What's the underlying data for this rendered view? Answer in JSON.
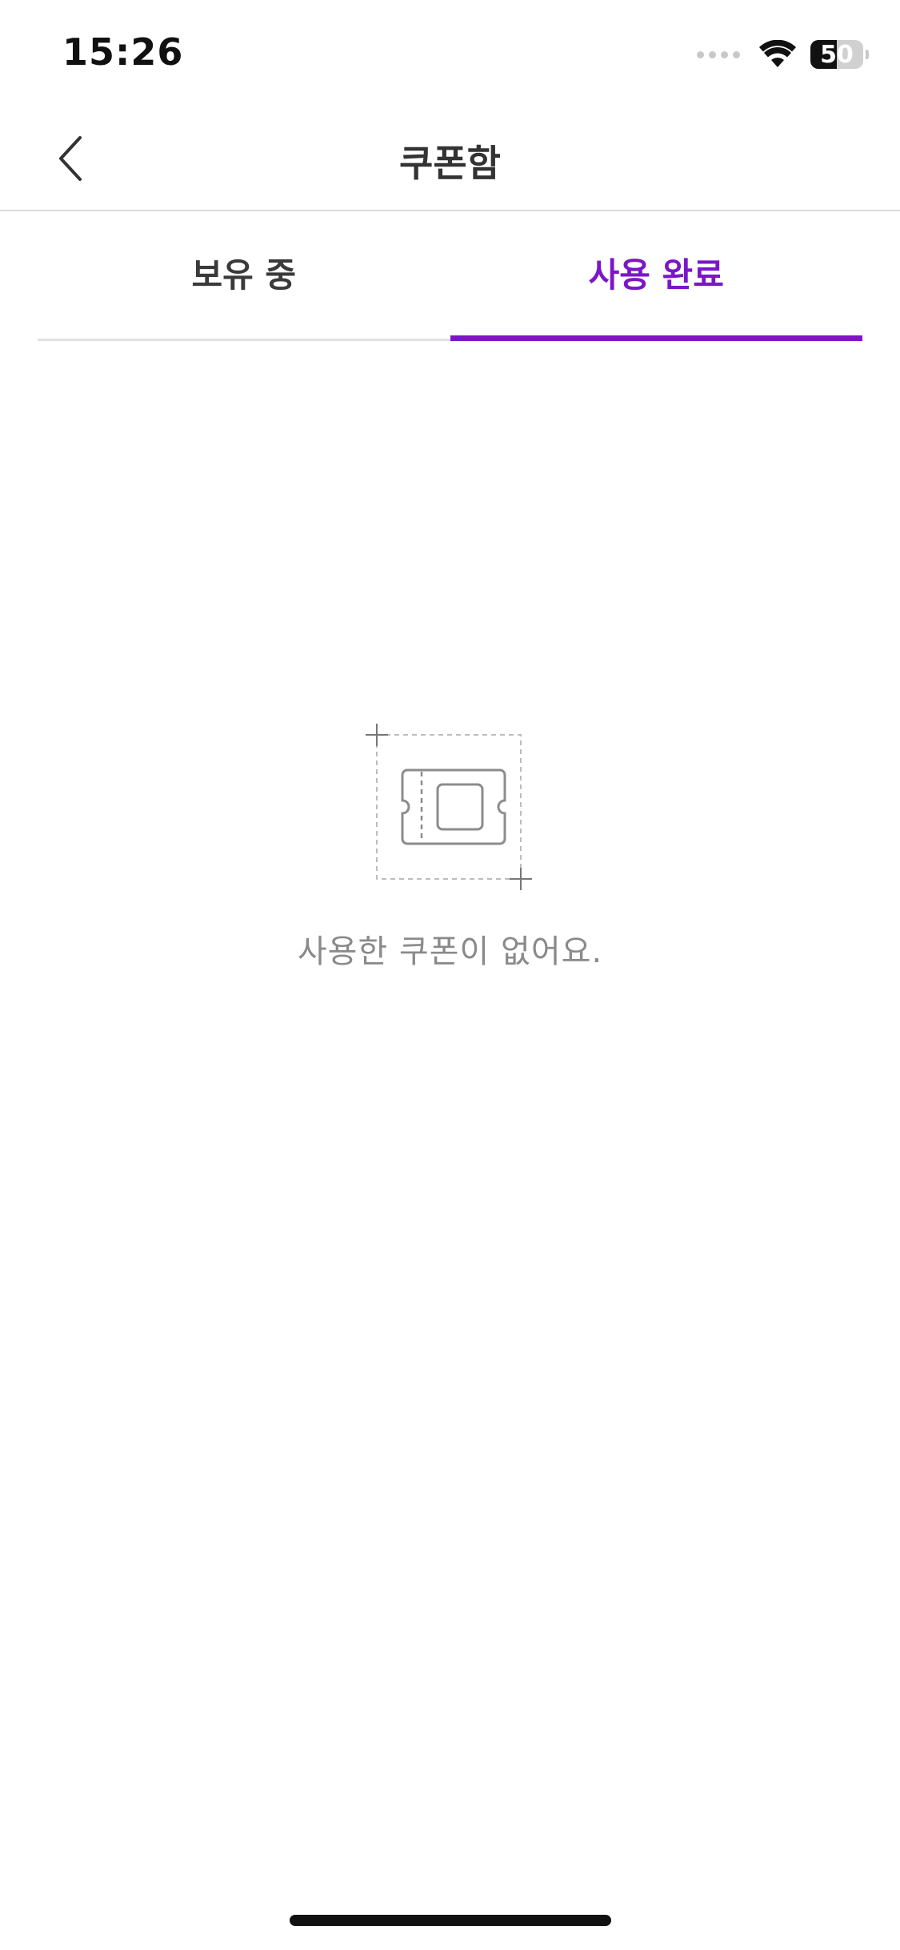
{
  "status_bar": {
    "time": "15:26",
    "battery_level": "50",
    "battery_fraction": 0.5,
    "icons": [
      "signal-dots-icon",
      "wifi-icon",
      "battery-icon"
    ]
  },
  "header": {
    "title": "쿠폰함",
    "back_icon": "chevron-left-icon"
  },
  "tabs": [
    {
      "label": "보유 중",
      "active": false
    },
    {
      "label": "사용 완료",
      "active": true
    }
  ],
  "empty_state": {
    "icon": "coupon-ticket-icon",
    "message": "사용한 쿠폰이 없어요."
  },
  "colors": {
    "accent": "#7b16c9",
    "text_primary": "#333333",
    "text_muted": "#8a8a8a",
    "divider": "#d9d9d9"
  }
}
